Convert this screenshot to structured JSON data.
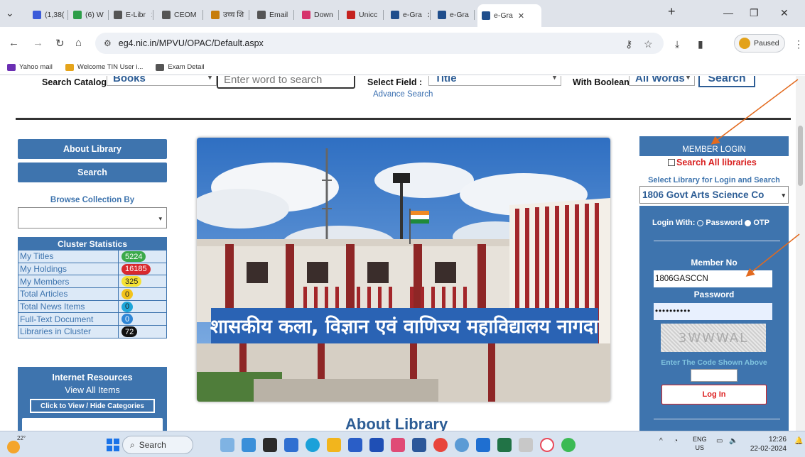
{
  "browser": {
    "tabs": [
      {
        "label": "(1,38(",
        "color": "#3b5bd9"
      },
      {
        "label": "(6) W",
        "color": "#2e9e49"
      },
      {
        "label": "E-Libr",
        "color": "#555555"
      },
      {
        "label": "CEOM",
        "color": "#555555"
      },
      {
        "label": "उच्च शि",
        "color": "#c77d0a"
      },
      {
        "label": "Email",
        "color": "#555555"
      },
      {
        "label": "Down",
        "color": "#d6336c"
      },
      {
        "label": "Unicc",
        "color": "#c5221f"
      },
      {
        "label": "e-Gra",
        "color": "#1f4e8c"
      },
      {
        "label": "e-Gra",
        "color": "#1f4e8c"
      },
      {
        "label": "e-Gra",
        "color": "#1f4e8c",
        "active": true
      }
    ],
    "new_tab": "+",
    "url": "eg4.nic.in/MPVU/OPAC/Default.aspx",
    "profile_status": "Paused"
  },
  "bookmarks": [
    {
      "label": "Yahoo mail",
      "color": "#6b2fb3"
    },
    {
      "label": "Welcome TIN User i...",
      "color": "#e5a41b"
    },
    {
      "label": "Exam Detail",
      "color": "#555555"
    }
  ],
  "search_bar": {
    "catalog_label": "Search Catalog",
    "catalog_value": "Books",
    "search_placeholder": "Enter word to search",
    "field_label": "Select Field :",
    "field_value": "Title",
    "boolean_label": "With Boolean:",
    "boolean_value": "All Words",
    "search_button": "Search",
    "advance_search": "Advance Search"
  },
  "left": {
    "about_library": "About Library",
    "search": "Search",
    "browse_collection": "Browse Collection By",
    "cluster_title": "Cluster Statistics",
    "cluster_rows": [
      {
        "label": "My Titles",
        "value": "5224",
        "bg": "#3aa94a",
        "fg": "#ffffff"
      },
      {
        "label": "My Holdings",
        "value": "16185",
        "bg": "#d9292e",
        "fg": "#ffffff"
      },
      {
        "label": "My Members",
        "value": "325",
        "bg": "#f5e232",
        "fg": "#222222"
      },
      {
        "label": "Total Articles",
        "value": "0",
        "bg": "#f2c31b",
        "fg": "#222222"
      },
      {
        "label": "Total News Items",
        "value": "0",
        "bg": "#1ea6d9",
        "fg": "#222222"
      },
      {
        "label": "Full-Text Document",
        "value": "0",
        "bg": "#2f86d6",
        "fg": "#ffffff"
      },
      {
        "label": "Libraries in Cluster",
        "value": "72",
        "bg": "#111111",
        "fg": "#ffffff"
      }
    ],
    "internet_resources": "Internet Resources",
    "view_all": "View All Items",
    "toggle_categories": "Click to View / Hide Categories"
  },
  "center": {
    "banner_text": "शासकीय कला, विज्ञान एवं वाणिज्य महाविद्यालय नागदा",
    "about_heading": "About Library"
  },
  "right": {
    "member_login": "MEMBER LOGIN",
    "search_all": "Search All libraries",
    "select_library": "Select Library for Login and Search",
    "library_value": "1806 Govt Arts Science Co",
    "login_with": "Login With:",
    "opt_password": "Password",
    "opt_otp": "OTP",
    "member_no_label": "Member No",
    "member_no_value": "1806GASCCN",
    "password_label": "Password",
    "password_value": "••••••••••",
    "captcha": "3WWWAL",
    "code_label": "Enter The Code Shown Above",
    "login_button": "Log In"
  },
  "taskbar": {
    "temperature": "22°",
    "search": "Search",
    "lang_1": "ENG",
    "lang_2": "US",
    "time": "12:26",
    "date": "22-02-2024"
  }
}
